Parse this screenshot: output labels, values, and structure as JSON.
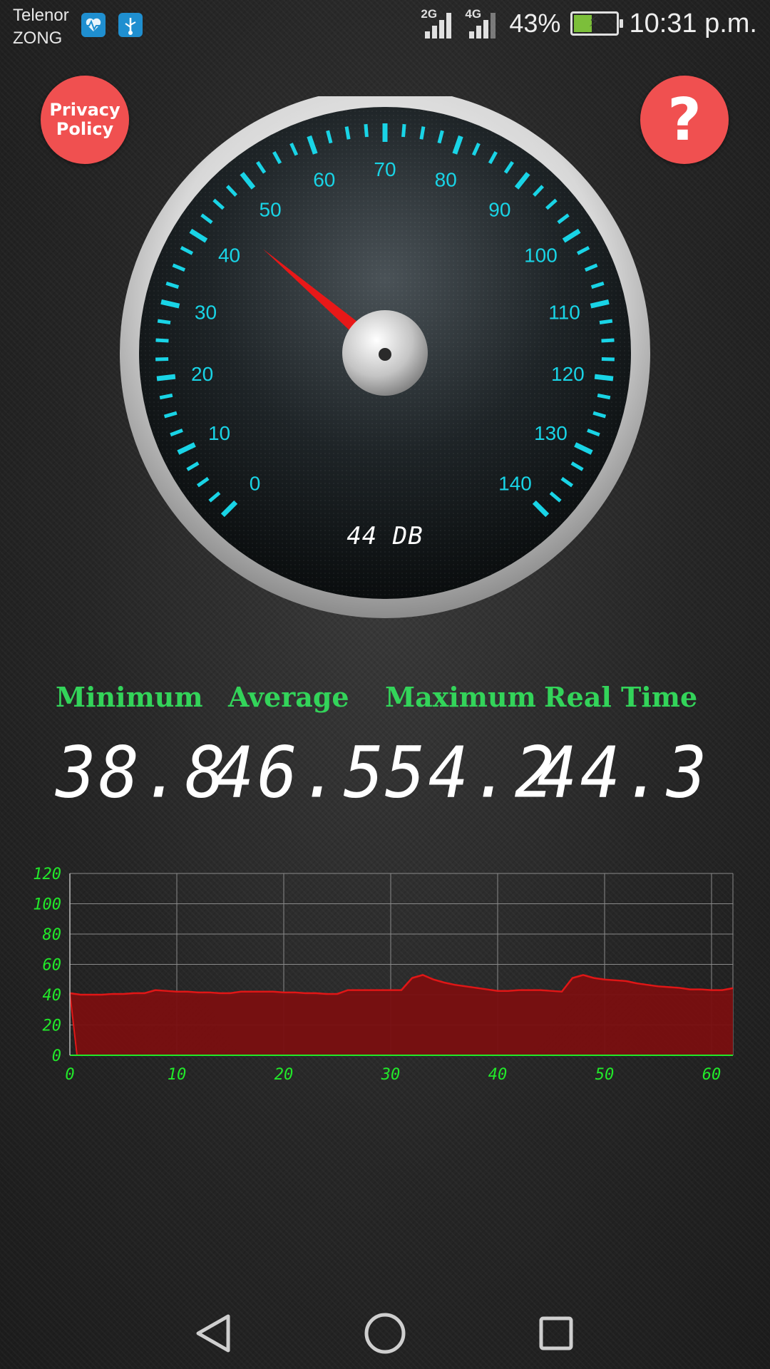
{
  "status_bar": {
    "carrier_1": "Telenor",
    "carrier_2": "ZONG",
    "app_icons": [
      "heart-monitor-icon",
      "usb-icon"
    ],
    "network_1": "2G",
    "network_2": "4G",
    "battery_percent": "43%",
    "battery_level": 0.43,
    "time": "10:31 p.m."
  },
  "buttons": {
    "privacy_line1": "Privacy",
    "privacy_line2": "Policy",
    "help": "?",
    "color": "#f05050"
  },
  "gauge": {
    "ticks": [
      "0",
      "10",
      "20",
      "30",
      "40",
      "50",
      "60",
      "70",
      "80",
      "90",
      "100",
      "110",
      "120",
      "130",
      "140"
    ],
    "min": 0,
    "max": 140,
    "needle_value": 44.3,
    "readout": "44 DB",
    "accent_color": "#19d4e6",
    "needle_color": "#e81818"
  },
  "stats": {
    "minimum_label": "Minimum",
    "minimum_value": "38.8",
    "average_label": "Average",
    "average_value": "46.5",
    "maximum_label": "Maximum",
    "maximum_value": "54.2",
    "realtime_label": "Real Time",
    "realtime_value": "44.3",
    "label_color": "#33d45a"
  },
  "chart_data": {
    "type": "area",
    "x": [
      0,
      1,
      2,
      3,
      4,
      5,
      6,
      7,
      8,
      9,
      10,
      11,
      12,
      13,
      14,
      15,
      16,
      17,
      18,
      19,
      20,
      21,
      22,
      23,
      24,
      25,
      26,
      27,
      28,
      29,
      30,
      31,
      32,
      33,
      34,
      35,
      36,
      37,
      38,
      39,
      40,
      41,
      42,
      43,
      44,
      45,
      46,
      47,
      48,
      49,
      50,
      51,
      52,
      53,
      54,
      55,
      56,
      57,
      58,
      59,
      60,
      61,
      62
    ],
    "values": [
      41,
      40,
      40,
      40,
      40.5,
      40.5,
      41,
      41,
      43,
      42.5,
      42,
      42,
      41.5,
      41.5,
      41,
      41,
      42,
      42,
      42,
      42,
      41.5,
      41.5,
      41,
      41,
      40.5,
      40.5,
      43,
      43,
      43,
      43,
      43,
      43,
      51,
      53,
      50,
      48,
      46.5,
      45.5,
      44.5,
      43.5,
      42.5,
      42.5,
      43,
      43,
      43,
      42.5,
      42,
      51,
      53,
      51,
      50,
      49.5,
      49,
      47.5,
      46.5,
      45.5,
      45,
      44.5,
      43.5,
      43.5,
      43,
      43,
      44.3
    ],
    "xticks": [
      "0",
      "10",
      "20",
      "30",
      "40",
      "50",
      "60"
    ],
    "yticks": [
      "0",
      "20",
      "40",
      "60",
      "80",
      "100",
      "120"
    ],
    "xlim": [
      0,
      62
    ],
    "ylim": [
      0,
      120
    ],
    "grid": true,
    "tick_color": "#22e82a",
    "fill_color": "#7a0f10",
    "line_color": "#e01616"
  },
  "nav": {
    "icons": [
      "back-triangle-icon",
      "home-circle-icon",
      "recents-square-icon"
    ]
  }
}
